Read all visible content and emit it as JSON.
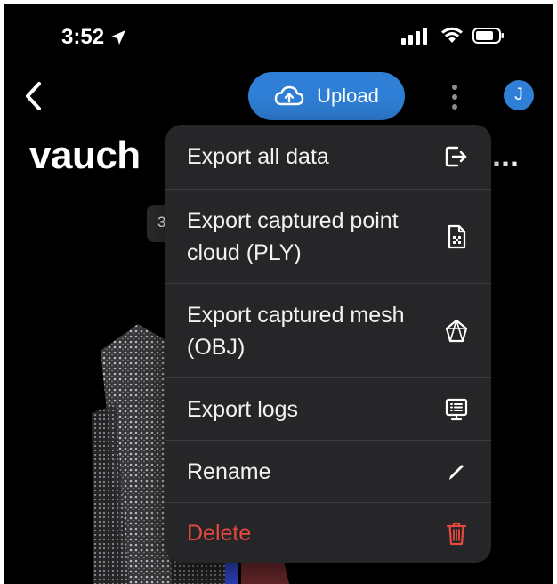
{
  "status_bar": {
    "time": "3:52"
  },
  "nav": {
    "upload_label": "Upload",
    "avatar_initial": "J"
  },
  "page": {
    "title": "vauch",
    "title_ellipsis": "...",
    "chip_text": "3"
  },
  "menu": {
    "items": [
      {
        "label": "Export all data",
        "icon": "export-icon"
      },
      {
        "label": "Export captured point cloud (PLY)",
        "icon": "file-icon"
      },
      {
        "label": "Export captured mesh (OBJ)",
        "icon": "mesh-icon"
      },
      {
        "label": "Export logs",
        "icon": "logs-icon"
      },
      {
        "label": "Rename",
        "icon": "pencil-icon"
      },
      {
        "label": "Delete",
        "icon": "trash-icon"
      }
    ]
  },
  "colors": {
    "accent": "#2f7fd6",
    "menu_bg": "#262628",
    "danger": "#e5483f"
  }
}
